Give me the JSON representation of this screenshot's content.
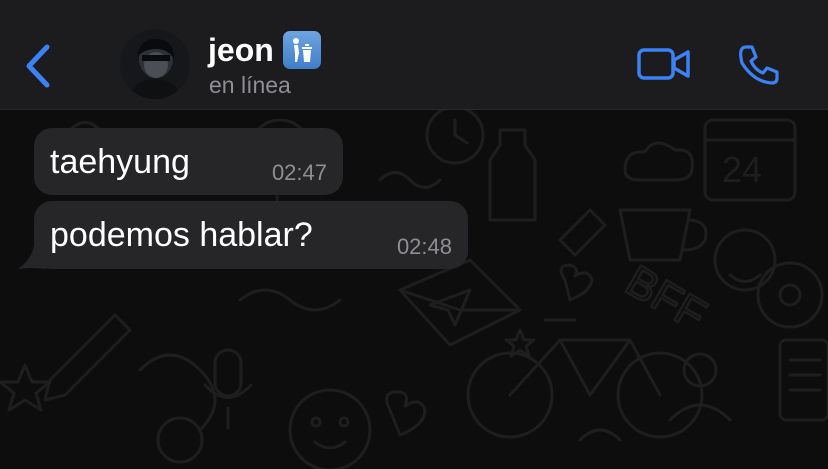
{
  "colors": {
    "accent": "#3b82f6",
    "header_bg": "#1c1c1e",
    "bubble_bg": "#262628",
    "chat_bg": "#0d0d0d",
    "status_text": "#8e8e93"
  },
  "header": {
    "back_icon": "chevron-left-icon",
    "contact": {
      "name": "jeon",
      "badge_icon": "trash-can-icon",
      "status": "en línea",
      "avatar": "profile-photo"
    },
    "actions": {
      "video_icon": "video-camera-icon",
      "call_icon": "phone-icon"
    }
  },
  "messages": [
    {
      "text": "taehyung",
      "time": "02:47",
      "direction": "incoming"
    },
    {
      "text": "podemos hablar?",
      "time": "02:48",
      "direction": "incoming"
    }
  ]
}
